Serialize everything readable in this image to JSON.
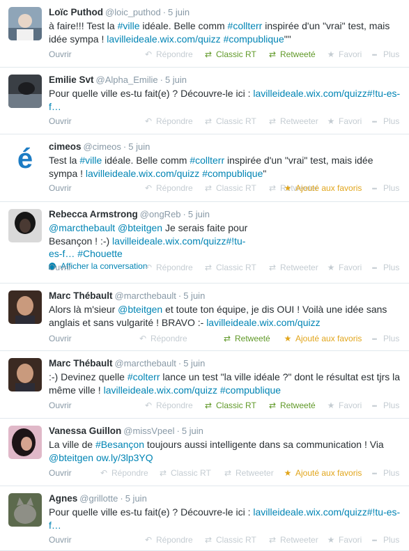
{
  "labels": {
    "open": "Ouvrir",
    "reply": "Répondre",
    "classic_rt": "Classic RT",
    "retweet": "Retweeter",
    "retweeted": "Retweeté",
    "favorite": "Favori",
    "favorited": "Ajouté aux favoris",
    "more": "Plus",
    "show_conversation": "Afficher la conversation"
  },
  "colors": {
    "link": "#0084b4",
    "retweeted": "#609928",
    "favorited": "#e1a51b",
    "muted": "#8899a6",
    "inactive": "#c4ccd2"
  },
  "tweets": [
    {
      "fullname": "Loïc Puthod",
      "username": "@loic_puthod",
      "date": "5 juin",
      "avatar": "avatar-loic",
      "text": [
        [
          "à faire!!! Test la ",
          "t"
        ],
        [
          "#ville",
          "l"
        ],
        [
          " idéale. Belle comm ",
          "t"
        ],
        [
          "#collterr",
          "l"
        ],
        [
          " inspirée d'un \"vrai\" test, mais idée sympa !  ",
          "t"
        ],
        [
          "lavilleideale.wix.com/quizz",
          "l"
        ],
        [
          " ",
          "t"
        ],
        [
          "#compublique",
          "l"
        ],
        [
          "\"\"",
          "t"
        ]
      ],
      "retweet_state": "retweeted",
      "favorite_state": "none"
    },
    {
      "fullname": "Emilie Svt",
      "username": "@Alpha_Emilie",
      "date": "5 juin",
      "avatar": "avatar-emilie",
      "text": [
        [
          "Pour quelle ville es-tu fait(e) ? Découvre-le ici :  ",
          "t"
        ],
        [
          "lavilleideale.wix.com/quizz#!tu-es-f…",
          "l"
        ]
      ],
      "retweet_state": "none",
      "favorite_state": "none"
    },
    {
      "fullname": "cimeos",
      "username": "@cimeos",
      "date": "5 juin",
      "avatar": "avatar-cimeos",
      "text": [
        [
          "Test la ",
          "t"
        ],
        [
          "#ville",
          "l"
        ],
        [
          " idéale. Belle comm ",
          "t"
        ],
        [
          "#collterr",
          "l"
        ],
        [
          " inspirée d'un \"vrai\" test, mais idée sympa !  ",
          "t"
        ],
        [
          "lavilleideale.wix.com/quizz",
          "l"
        ],
        [
          " ",
          "t"
        ],
        [
          "#compublique",
          "l"
        ],
        [
          "\"",
          "t"
        ]
      ],
      "retweet_state": "none",
      "favorite_state": "favorited"
    },
    {
      "fullname": "Rebecca Armstrong",
      "username": "@ongReb",
      "date": "5 juin",
      "avatar": "avatar-rebecca",
      "text": [
        [
          "@marcthebault",
          "l"
        ],
        [
          " ",
          "t"
        ],
        [
          "@bteitgen",
          "l"
        ],
        [
          " Je serais faite pour Besançon ! :-) ",
          "t"
        ],
        [
          "lavilleideale.wix.com/quizz#!tu-es-f…",
          "l"
        ],
        [
          " ",
          "t"
        ],
        [
          "#Chouette",
          "l"
        ]
      ],
      "show_conversation": true,
      "retweet_state": "none",
      "favorite_state": "none"
    },
    {
      "fullname": "Marc Thébault",
      "username": "@marcthebault",
      "date": "5 juin",
      "avatar": "avatar-marc",
      "text": [
        [
          "Alors là m'sieur ",
          "t"
        ],
        [
          "@bteitgen",
          "l"
        ],
        [
          " et toute ton équipe, je dis OUI ! Voilà une idée sans anglais et sans vulgarité ! BRAVO :- ",
          "t"
        ],
        [
          "lavilleideale.wix.com/quizz",
          "l"
        ]
      ],
      "retweet_state": "retweeted_single",
      "favorite_state": "favorited"
    },
    {
      "fullname": "Marc Thébault",
      "username": "@marcthebault",
      "date": "5 juin",
      "avatar": "avatar-marc",
      "text": [
        [
          ":-) Devinez quelle ",
          "t"
        ],
        [
          "#colterr",
          "l"
        ],
        [
          " lance un test \"la ville idéale ?\" dont le résultat est tjrs la même ville ! ",
          "t"
        ],
        [
          "lavilleideale.wix.com/quizz",
          "l"
        ],
        [
          " ",
          "t"
        ],
        [
          "#compublique",
          "l"
        ]
      ],
      "retweet_state": "retweeted",
      "favorite_state": "none"
    },
    {
      "fullname": "Vanessa Guillon",
      "username": "@missVpeel",
      "date": "5 juin",
      "avatar": "avatar-vanessa",
      "text": [
        [
          "La ville de ",
          "t"
        ],
        [
          "#Besançon",
          "l"
        ],
        [
          " toujours aussi intelligente dans sa communication ! Via ",
          "t"
        ],
        [
          "@bteitgen",
          "l"
        ],
        [
          " ",
          "t"
        ],
        [
          "ow.ly/3lp3YQ",
          "l"
        ]
      ],
      "retweet_state": "none",
      "favorite_state": "favorited"
    },
    {
      "fullname": "Agnes",
      "username": "@grillotte",
      "date": "5 juin",
      "avatar": "avatar-agnes",
      "text": [
        [
          "Pour quelle ville es-tu fait(e) ? Découvre-le ici :  ",
          "t"
        ],
        [
          "lavilleideale.wix.com/quizz#!tu-es-f…",
          "l"
        ]
      ],
      "retweet_state": "none",
      "favorite_state": "none"
    }
  ]
}
